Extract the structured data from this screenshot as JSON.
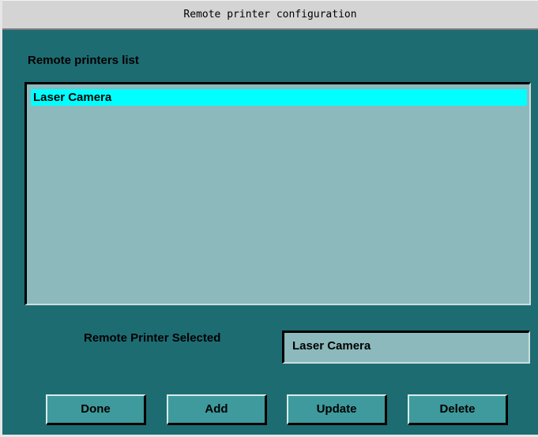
{
  "window": {
    "title": "Remote printer configuration"
  },
  "printers_list": {
    "label": "Remote printers list",
    "items": [
      {
        "label": "Laser Camera",
        "selected": true
      }
    ]
  },
  "selected_printer": {
    "label": "Remote Printer Selected",
    "value": "Laser Camera"
  },
  "buttons": {
    "done": "Done",
    "add": "Add",
    "update": "Update",
    "delete": "Delete"
  },
  "colors": {
    "window_bg": "#1d6c72",
    "list_bg": "#8cb9bc",
    "selection": "#00ffff",
    "button_bg": "#3e9a9c",
    "titlebar_bg": "#d4d4d4"
  }
}
